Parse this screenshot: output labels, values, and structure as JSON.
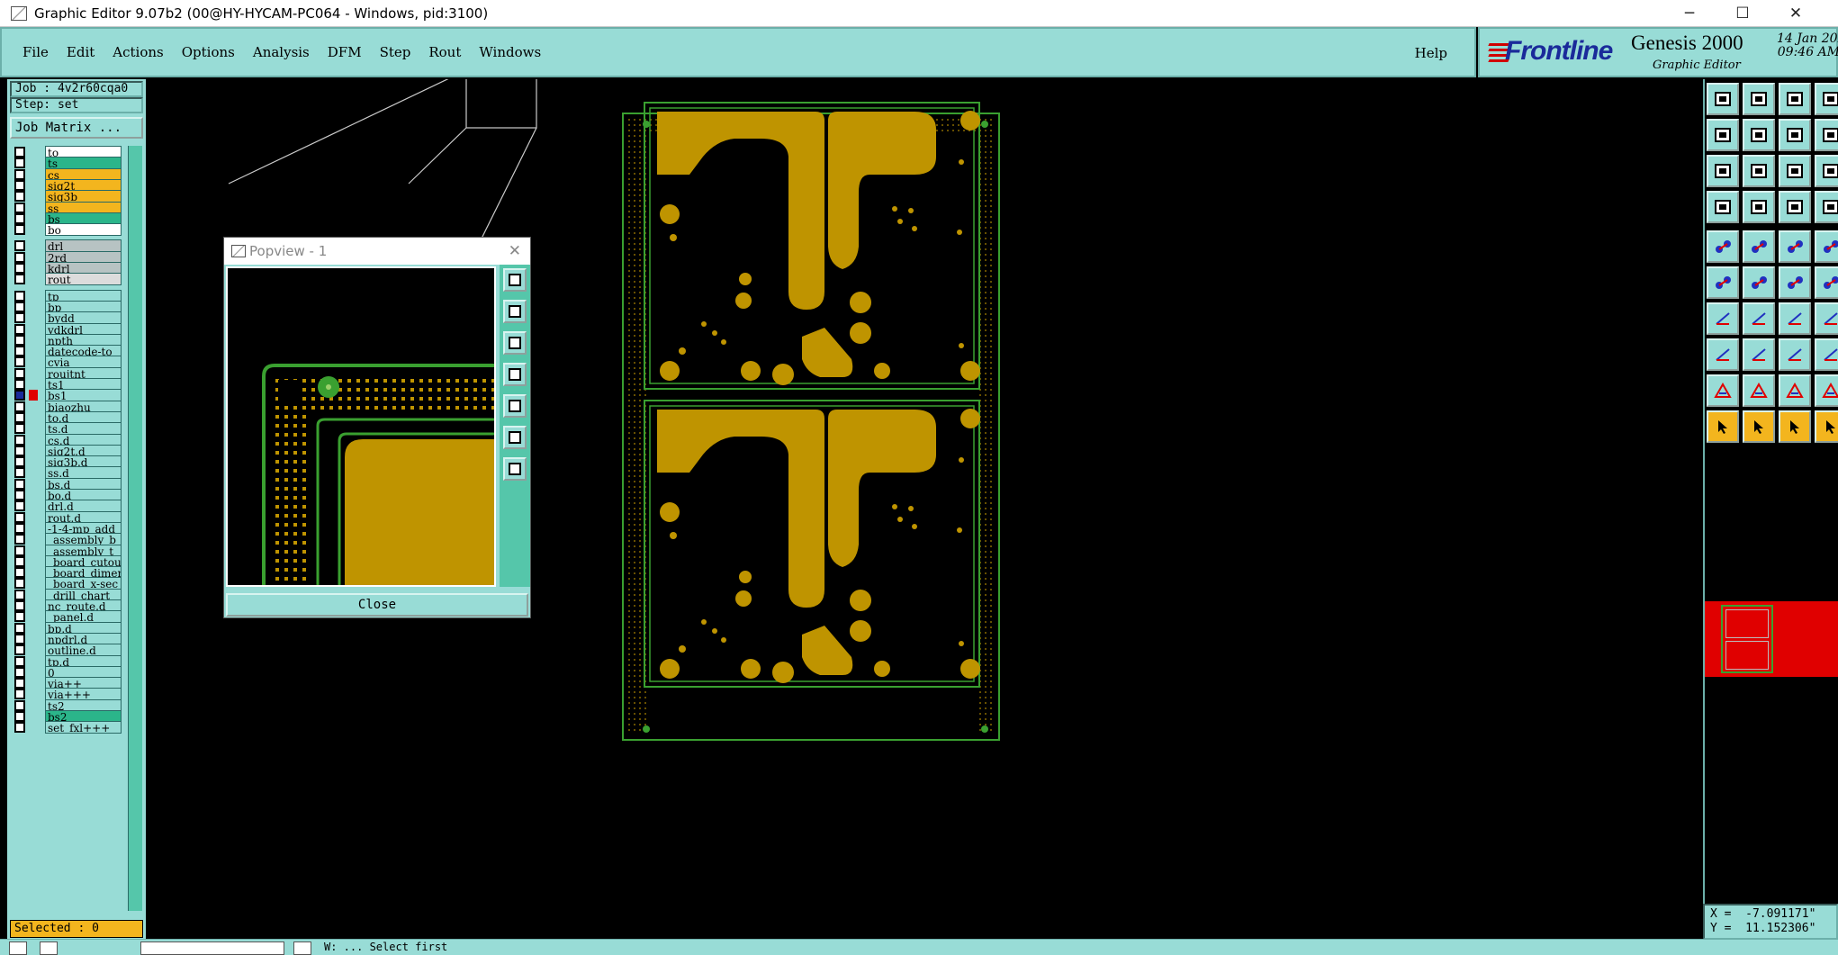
{
  "window": {
    "title": "Graphic Editor 9.07b2 (00@HY-HYCAM-PC064 - Windows, pid:3100)",
    "minimize": "─",
    "maximize": "☐",
    "close": "✕"
  },
  "menu": {
    "items": [
      "File",
      "Edit",
      "Actions",
      "Options",
      "Analysis",
      "DFM",
      "Step",
      "Rout",
      "Windows"
    ],
    "help": "Help"
  },
  "logo": {
    "brand": "Frontline",
    "product": "Genesis 2000",
    "subtitle": "Graphic Editor",
    "date": "14 Jan 202",
    "time": "09:46 AM"
  },
  "job": {
    "job_label": "Job : 4v2r60cqa0",
    "step_label": "Step: set",
    "matrix_button": "Job Matrix ..."
  },
  "layers": [
    {
      "name": "to",
      "color": "#ffffff"
    },
    {
      "name": "ts",
      "color": "#2bb58a"
    },
    {
      "name": "cs",
      "color": "#f3b51e"
    },
    {
      "name": "sig2t",
      "color": "#f3b51e"
    },
    {
      "name": "sig3b",
      "color": "#f3b51e"
    },
    {
      "name": "ss",
      "color": "#f3b51e"
    },
    {
      "name": "bs",
      "color": "#2bb58a"
    },
    {
      "name": "bo",
      "color": "#ffffff"
    },
    {
      "name": "drl",
      "color": "#b7c3c3"
    },
    {
      "name": "2rd",
      "color": "#b7c3c3"
    },
    {
      "name": "kdrl",
      "color": "#b7c3c3"
    },
    {
      "name": "rout",
      "color": "#dcdcdc"
    },
    {
      "name": "tp",
      "color": "#98dcd6"
    },
    {
      "name": "bp",
      "color": "#98dcd6"
    },
    {
      "name": "bydd",
      "color": "#98dcd6"
    },
    {
      "name": "ydkdrl",
      "color": "#98dcd6"
    },
    {
      "name": "npth",
      "color": "#98dcd6"
    },
    {
      "name": "datecode-to",
      "color": "#98dcd6"
    },
    {
      "name": "cvia",
      "color": "#98dcd6"
    },
    {
      "name": "roujtnt",
      "color": "#98dcd6"
    },
    {
      "name": "ts1",
      "color": "#98dcd6"
    },
    {
      "name": "bs1",
      "color": "#98dcd6"
    },
    {
      "name": "biaozhu",
      "color": "#98dcd6"
    },
    {
      "name": "to.d",
      "color": "#98dcd6"
    },
    {
      "name": "ts.d",
      "color": "#98dcd6"
    },
    {
      "name": "cs.d",
      "color": "#98dcd6"
    },
    {
      "name": "sig2t.d",
      "color": "#98dcd6"
    },
    {
      "name": "sig3b.d",
      "color": "#98dcd6"
    },
    {
      "name": "ss.d",
      "color": "#98dcd6"
    },
    {
      "name": "bs.d",
      "color": "#98dcd6"
    },
    {
      "name": "bo.d",
      "color": "#98dcd6"
    },
    {
      "name": "drl.d",
      "color": "#98dcd6"
    },
    {
      "name": "rout.d",
      "color": "#98dcd6"
    },
    {
      "name": "-1-4-mp_add",
      "color": "#98dcd6"
    },
    {
      "name": "_assembly_b",
      "color": "#98dcd6"
    },
    {
      "name": "_assembly_t",
      "color": "#98dcd6"
    },
    {
      "name": "_board_cutou",
      "color": "#98dcd6"
    },
    {
      "name": "_board_dimen",
      "color": "#98dcd6"
    },
    {
      "name": "_board_x-sec",
      "color": "#98dcd6"
    },
    {
      "name": "_drill_chart",
      "color": "#98dcd6"
    },
    {
      "name": "nc_route.d",
      "color": "#98dcd6"
    },
    {
      "name": "_panel.d",
      "color": "#98dcd6"
    },
    {
      "name": "bp.d",
      "color": "#98dcd6"
    },
    {
      "name": "npdrl.d",
      "color": "#98dcd6"
    },
    {
      "name": "outline.d",
      "color": "#98dcd6"
    },
    {
      "name": "tp.d",
      "color": "#98dcd6"
    },
    {
      "name": "0",
      "color": "#98dcd6"
    },
    {
      "name": "via++",
      "color": "#98dcd6"
    },
    {
      "name": "via+++",
      "color": "#98dcd6"
    },
    {
      "name": "ts2",
      "color": "#98dcd6"
    },
    {
      "name": "bs2",
      "color": "#2bb58a"
    },
    {
      "name": "set_fxl+++",
      "color": "#98dcd6"
    }
  ],
  "selected": "Selected : 0",
  "popview": {
    "title": "Popview - 1",
    "close_button": "Close"
  },
  "coords": {
    "x": "X =  -7.091171\"",
    "y": "Y =  11.152306\""
  },
  "status": {
    "message": "W: ... Select first"
  },
  "colors": {
    "panel": "#98dcd6",
    "copper": "#bf9400",
    "outline": "#3aa030",
    "active_layer": "#f3b51e",
    "highlight": "#e00000"
  }
}
